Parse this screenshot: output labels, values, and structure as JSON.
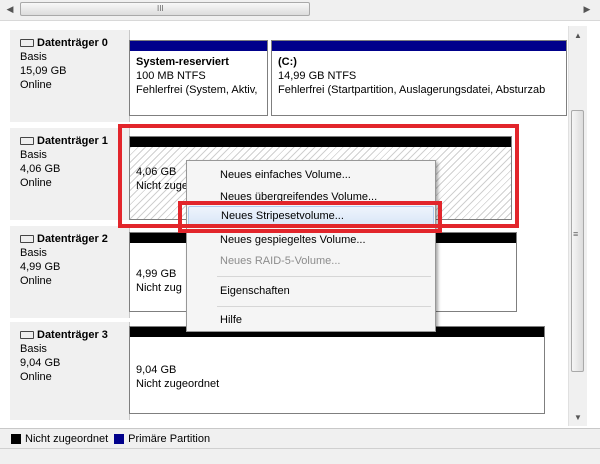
{
  "scrollbar": {
    "grip": "III"
  },
  "disks": [
    {
      "name": "Datenträger 0",
      "type": "Basis",
      "size": "15,09 GB",
      "status": "Online",
      "partitions": [
        {
          "title": "System-reserviert",
          "detail": "100 MB NTFS",
          "state": "Fehlerfrei (System, Aktiv,"
        },
        {
          "title": "(C:)",
          "detail": "14,99 GB NTFS",
          "state": "Fehlerfrei (Startpartition, Auslagerungsdatei, Absturzab"
        }
      ]
    },
    {
      "name": "Datenträger 1",
      "type": "Basis",
      "size": "4,06 GB",
      "status": "Online",
      "partitions": [
        {
          "detail": "4,06 GB",
          "state": "Nicht zugeo"
        }
      ]
    },
    {
      "name": "Datenträger 2",
      "type": "Basis",
      "size": "4,99 GB",
      "status": "Online",
      "partitions": [
        {
          "detail": "4,99 GB",
          "state": "Nicht zug"
        }
      ]
    },
    {
      "name": "Datenträger 3",
      "type": "Basis",
      "size": "9,04 GB",
      "status": "Online",
      "partitions": [
        {
          "detail": "9,04 GB",
          "state": "Nicht zugeordnet"
        }
      ]
    }
  ],
  "context_menu": {
    "items": [
      {
        "label": "Neues einfaches Volume...",
        "enabled": true
      },
      {
        "label": "Neues übergreifendes Volume...",
        "enabled": true
      },
      {
        "label": "Neues Stripesetvolume...",
        "enabled": true,
        "highlighted": true
      },
      {
        "label": "Neues gespiegeltes Volume...",
        "enabled": true
      },
      {
        "label": "Neues RAID-5-Volume...",
        "enabled": false
      },
      {
        "label": "Eigenschaften",
        "enabled": true
      },
      {
        "label": "Hilfe",
        "enabled": true
      }
    ]
  },
  "legend": [
    {
      "label": "Nicht zugeordnet",
      "color": "#000000"
    },
    {
      "label": "Primäre Partition",
      "color": "#00008b"
    }
  ],
  "colors": {
    "highlight": "#e2252b",
    "primary": "#00008b",
    "unallocated": "#000000"
  }
}
